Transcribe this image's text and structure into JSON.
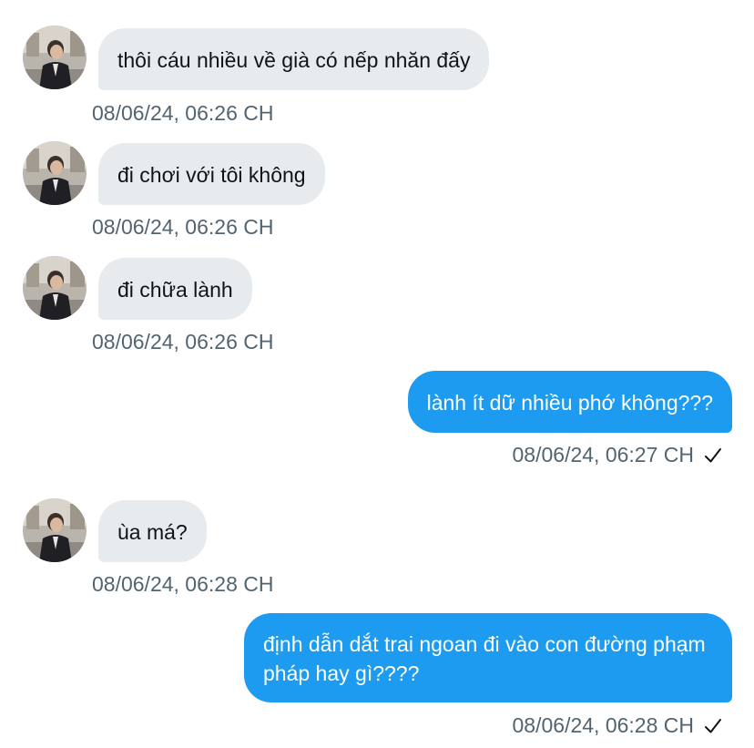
{
  "messages": [
    {
      "direction": "incoming",
      "text": "thôi cáu nhiều về già có nếp nhăn đấy",
      "time": "08/06/24, 06:26 CH"
    },
    {
      "direction": "incoming",
      "text": "đi chơi với tôi không",
      "time": "08/06/24, 06:26 CH"
    },
    {
      "direction": "incoming",
      "text": "đi chữa lành",
      "time": "08/06/24, 06:26 CH"
    },
    {
      "direction": "outgoing",
      "text": "lành ít dữ nhiều phớ không???",
      "time": "08/06/24, 06:27 CH",
      "status_icon": "checkmark-icon"
    },
    {
      "direction": "incoming",
      "text": "ùa má?",
      "time": "08/06/24, 06:28 CH"
    },
    {
      "direction": "outgoing",
      "text": "định dẫn dắt trai ngoan đi vào con đường phạm pháp hay gì????",
      "time": "08/06/24, 06:28 CH",
      "status_icon": "checkmark-icon"
    }
  ],
  "colors": {
    "incoming_bubble": "#e7ebee",
    "outgoing_bubble": "#1d9bf0",
    "timestamp": "#536471",
    "text": "#0f1419"
  }
}
